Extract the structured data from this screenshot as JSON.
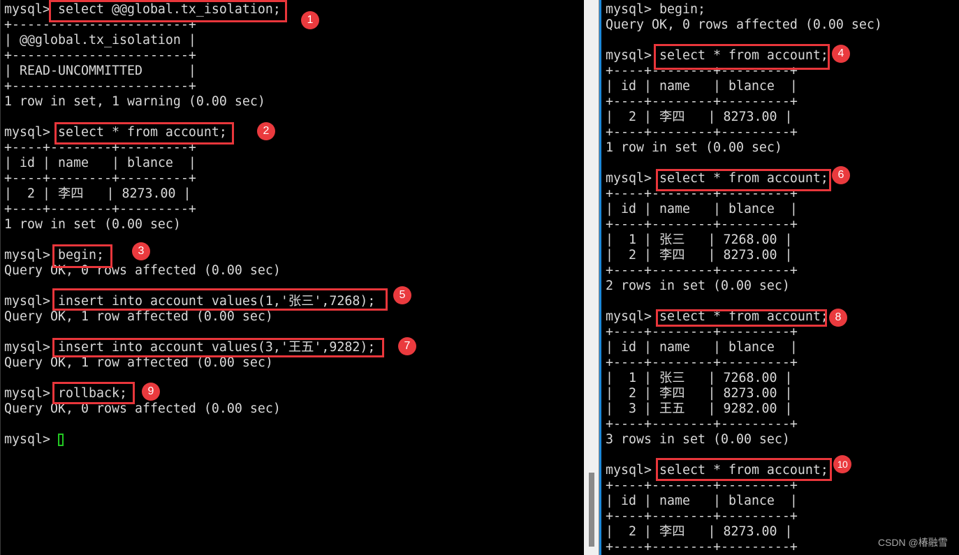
{
  "left_terminal": {
    "lines": [
      "mysql> select @@global.tx_isolation;",
      "+-----------------------+",
      "| @@global.tx_isolation |",
      "+-----------------------+",
      "| READ-UNCOMMITTED      |",
      "+-----------------------+",
      "1 row in set, 1 warning (0.00 sec)",
      "",
      "mysql> select * from account;",
      "+----+--------+---------+",
      "| id | name   | blance  |",
      "+----+--------+---------+",
      "|  2 | 李四   | 8273.00 |",
      "+----+--------+---------+",
      "1 row in set (0.00 sec)",
      "",
      "mysql> begin;",
      "Query OK, 0 rows affected (0.00 sec)",
      "",
      "mysql> insert into account values(1,'张三',7268);",
      "Query OK, 1 row affected (0.00 sec)",
      "",
      "mysql> insert into account values(3,'王五',9282);",
      "Query OK, 1 row affected (0.00 sec)",
      "",
      "mysql> rollback;",
      "Query OK, 0 rows affected (0.00 sec)",
      "",
      "mysql> "
    ],
    "cursor_color": "#22c822"
  },
  "right_terminal": {
    "lines": [
      "mysql> begin;",
      "Query OK, 0 rows affected (0.00 sec)",
      "",
      "mysql> select * from account;",
      "+----+--------+---------+",
      "| id | name   | blance  |",
      "+----+--------+---------+",
      "|  2 | 李四   | 8273.00 |",
      "+----+--------+---------+",
      "1 row in set (0.00 sec)",
      "",
      "mysql> select * from account;",
      "+----+--------+---------+",
      "| id | name   | blance  |",
      "+----+--------+---------+",
      "|  1 | 张三   | 7268.00 |",
      "|  2 | 李四   | 8273.00 |",
      "+----+--------+---------+",
      "2 rows in set (0.00 sec)",
      "",
      "mysql> select * from account;",
      "+----+--------+---------+",
      "| id | name   | blance  |",
      "+----+--------+---------+",
      "|  1 | 张三   | 7268.00 |",
      "|  2 | 李四   | 8273.00 |",
      "|  3 | 王五   | 9282.00 |",
      "+----+--------+---------+",
      "3 rows in set (0.00 sec)",
      "",
      "mysql> select * from account;",
      "+----+--------+---------+",
      "| id | name   | blance  |",
      "+----+--------+---------+",
      "|  2 | 李四   | 8273.00 |",
      "+----+--------+---------+"
    ]
  },
  "annotations": {
    "badges": [
      "1",
      "2",
      "3",
      "4",
      "5",
      "6",
      "7",
      "8",
      "9",
      "10"
    ],
    "highlight_color": "#e8363b",
    "badge_color": "#ea3a3e"
  },
  "watermark": "CSDN @椿融雪"
}
